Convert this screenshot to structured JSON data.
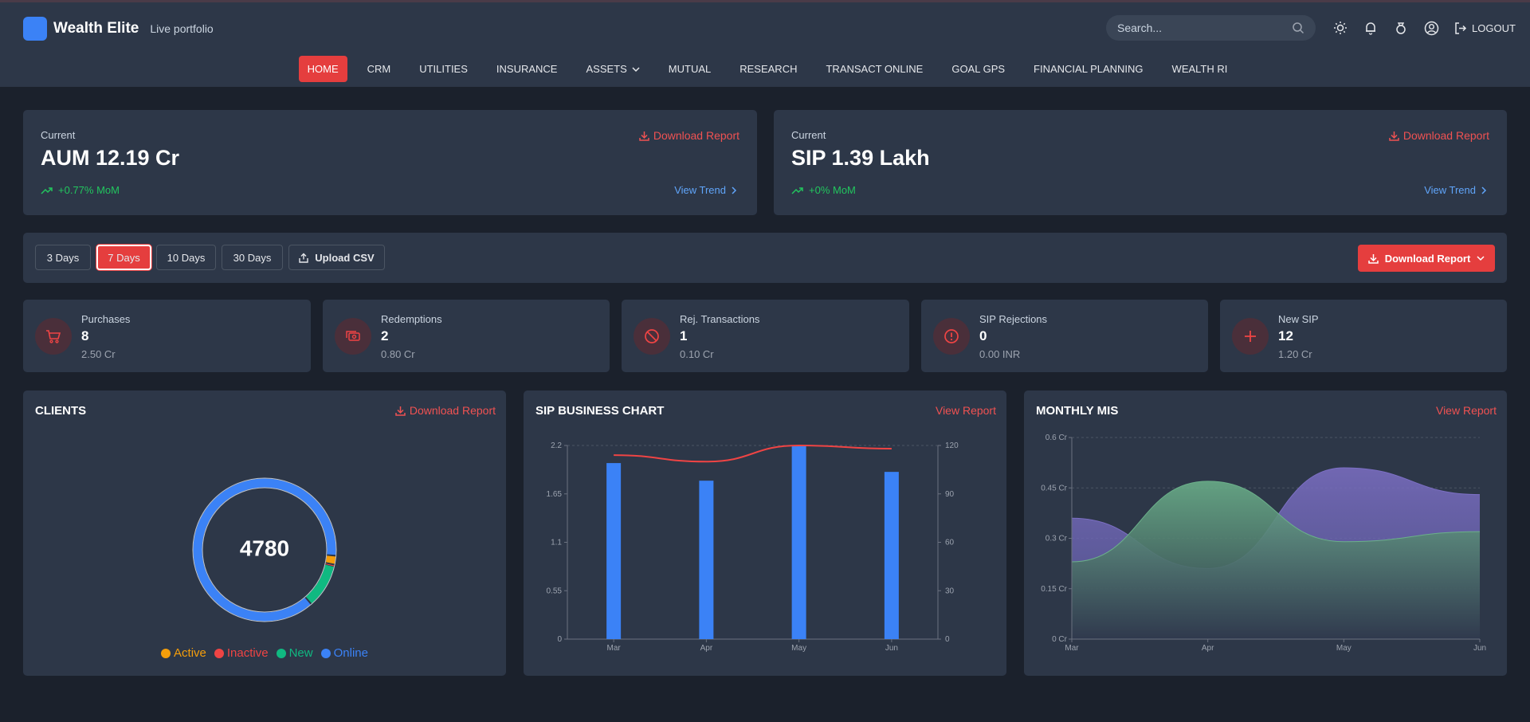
{
  "header": {
    "brand": "Wealth Elite",
    "tagline": "Live portfolio",
    "search_placeholder": "Search...",
    "logout_label": "LOGOUT"
  },
  "nav": {
    "items": [
      {
        "label": "HOME",
        "active": true
      },
      {
        "label": "CRM"
      },
      {
        "label": "UTILITIES"
      },
      {
        "label": "INSURANCE"
      },
      {
        "label": "ASSETS",
        "dropdown": true
      },
      {
        "label": "MUTUAL"
      },
      {
        "label": "RESEARCH"
      },
      {
        "label": "TRANSACT ONLINE"
      },
      {
        "label": "GOAL GPS"
      },
      {
        "label": "FINANCIAL PLANNING"
      },
      {
        "label": "WEALTH RI"
      }
    ]
  },
  "summary": {
    "aum": {
      "current_label": "Current",
      "value": "AUM 12.19 Cr",
      "change": "+0.77% MoM",
      "download": "Download Report",
      "trend": "View Trend"
    },
    "sip": {
      "current_label": "Current",
      "value": "SIP 1.39 Lakh",
      "change": "+0% MoM",
      "download": "Download Report",
      "trend": "View Trend"
    }
  },
  "filters": {
    "buttons": [
      "3 Days",
      "7 Days",
      "10 Days",
      "30 Days"
    ],
    "selected": "7 Days",
    "upload": "Upload CSV",
    "download": "Download Report"
  },
  "stats": [
    {
      "label": "Purchases",
      "value": "8",
      "sub": "2.50 Cr",
      "icon": "cart-icon"
    },
    {
      "label": "Redemptions",
      "value": "2",
      "sub": "0.80 Cr",
      "icon": "cash-icon"
    },
    {
      "label": "Rej. Transactions",
      "value": "1",
      "sub": "0.10 Cr",
      "icon": "ban-icon"
    },
    {
      "label": "SIP Rejections",
      "value": "0",
      "sub": "0.00 INR",
      "icon": "alert-icon"
    },
    {
      "label": "New SIP",
      "value": "12",
      "sub": "1.20 Cr",
      "icon": "plus-icon"
    }
  ],
  "clients": {
    "title": "CLIENTS",
    "download": "Download Report",
    "total": "4780",
    "legend": [
      {
        "name": "Active",
        "color": "#f59e0b"
      },
      {
        "name": "Inactive",
        "color": "#ef4444"
      },
      {
        "name": "New",
        "color": "#10b981"
      },
      {
        "name": "Online",
        "color": "#3b82f6"
      }
    ]
  },
  "sip_chart": {
    "title": "SIP BUSINESS CHART",
    "link": "View Report"
  },
  "mis_chart": {
    "title": "MONTHLY MIS",
    "link": "View Report"
  },
  "chart_data": [
    {
      "type": "pie",
      "chart": "clients-donut",
      "labels": [
        "Active",
        "Inactive",
        "New",
        "Online"
      ],
      "values": [
        96,
        15,
        480,
        4189
      ],
      "colors": [
        "#f59e0b",
        "#ef4444",
        "#10b981",
        "#3b82f6"
      ],
      "center_label": "4780"
    },
    {
      "type": "bar",
      "chart": "sip-business",
      "categories": [
        "Mar",
        "Apr",
        "May",
        "Jun"
      ],
      "series": [
        {
          "type": "bar",
          "axis": "left",
          "values": [
            2.0,
            1.8,
            2.2,
            1.9
          ],
          "color": "#3b82f6"
        },
        {
          "type": "line",
          "axis": "right",
          "values": [
            114,
            110,
            120,
            118
          ],
          "color": "#ef4444"
        }
      ],
      "ylim": [
        0,
        2.2
      ],
      "yticks": [
        "0",
        "0.55",
        "1.1",
        "1.65",
        "2.2"
      ],
      "y2lim": [
        0,
        120
      ],
      "y2ticks": [
        "0",
        "30",
        "60",
        "90",
        "120"
      ]
    },
    {
      "type": "area",
      "chart": "monthly-mis",
      "categories": [
        "Mar",
        "Apr",
        "May",
        "Jun"
      ],
      "series": [
        {
          "values": [
            0.36,
            0.21,
            0.51,
            0.43
          ],
          "color": "#7c6fc4"
        },
        {
          "values": [
            0.23,
            0.47,
            0.29,
            0.32
          ],
          "color": "#6bb08a"
        }
      ],
      "ylim": [
        0,
        0.6
      ],
      "yticks": [
        "0 Cr",
        "0.15 Cr",
        "0.3 Cr",
        "0.45 Cr",
        "0.6 Cr"
      ]
    }
  ]
}
